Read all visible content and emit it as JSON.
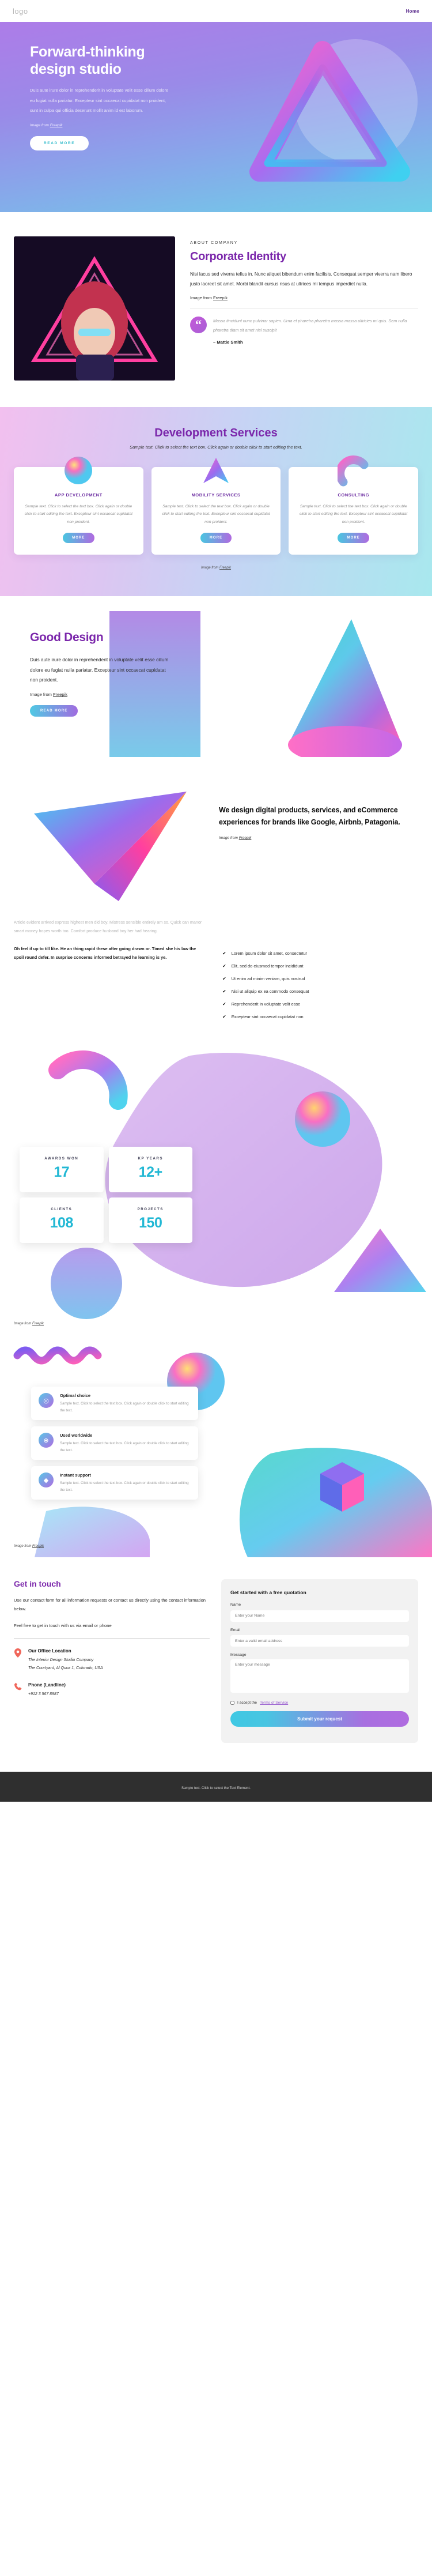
{
  "nav": {
    "logo": "logo",
    "home": "Home"
  },
  "hero": {
    "title": "Forward-thinking design studio",
    "body": "Duis aute irure dolor in reprehenderit in voluptate velit esse cillum dolore eu fugiat nulla pariatur. Excepteur sint occaecat cupidatat non proident, sunt in culpa qui officia deserunt mollit anim id est laborum.",
    "credit_prefix": "Image from ",
    "credit_link": "Freepik",
    "cta": "READ MORE"
  },
  "about": {
    "eyebrow": "ABOUT COMPANY",
    "title": "Corporate Identity",
    "body": "Nisi lacus sed viverra tellus in. Nunc aliquet bibendum enim facilisis. Consequat semper viverra nam libero justo laoreet sit amet. Morbi blandit cursus risus at ultrices mi tempus imperdiet nulla.",
    "credit_prefix": "Image from ",
    "credit_link": "Freepik",
    "quote_glyph": "“",
    "quote": "Massa tincidunt nunc pulvinar sapien. Urna et pharetra pharetra massa massa ultricies mi quis. Sem nulla pharetra diam sit amet nisl suscipit",
    "author": "– Mattie Smith"
  },
  "services": {
    "title": "Development Services",
    "subtitle": "Sample text. Click to select the text box. Click again or double click to start editing the text.",
    "credit_prefix": "Image from ",
    "credit_link": "Freepik",
    "cards": [
      {
        "title": "APP DEVELOPMENT",
        "body": "Sample text. Click to select the text box. Click again or double click to start editing the text. Excepteur sint occaecat cupidatat non proident.",
        "cta": "MORE"
      },
      {
        "title": "MOBILITY SERVICES",
        "body": "Sample text. Click to select the text box. Click again or double click to start editing the text. Excepteur sint occaecat cupidatat non proident.",
        "cta": "MORE"
      },
      {
        "title": "CONSULTING",
        "body": "Sample text. Click to select the text box. Click again or double click to start editing the text. Excepteur sint occaecat cupidatat non proident.",
        "cta": "MORE"
      }
    ]
  },
  "good_design": {
    "title": "Good Design",
    "body": "Duis aute irure dolor in reprehenderit in voluptate velit esse cillum dolore eu fugiat nulla pariatur. Excepteur sint occaecat cupidatat non proident.",
    "credit_prefix": "Image from ",
    "credit_link": "Freepik",
    "cta": "READ MORE"
  },
  "digital": {
    "title": "We design digital products, services, and eCommerce experiences for brands like Google, Airbnb, Patagonia.",
    "credit_prefix": "Image from ",
    "credit_link": "Freepik",
    "faded": "Article evident arrived express highest men did boy. Mistress sensible entirely am so. Quick can manor smart money hopes worth too. Comfort produce husband boy her had hearing.",
    "strong": "Oh feel if up to till like. He an thing rapid these after going drawn or. Timed she his law the spoil round defer. In surprise concerns informed betrayed he learning is ye.",
    "checks": [
      "Lorem ipsum dolor sit amet, consectetur",
      "Elit, sed do eiusmod tempor incididunt",
      "Ut enim ad minim veniam, quis nostrud",
      "Nisi ut aliquip ex ea commodo consequat",
      "Reprehenderit in voluptate velit esse",
      "Excepteur sint occaecat cupidatat non"
    ],
    "tick": "✔"
  },
  "stats": {
    "items": [
      {
        "label": "AWARDS WON",
        "value": "17"
      },
      {
        "label": "KP YEARS",
        "value": "12+"
      },
      {
        "label": "CLIENTS",
        "value": "108"
      },
      {
        "label": "PROJECTS",
        "value": "150"
      }
    ],
    "credit_prefix": "Image from ",
    "credit_link": "Freepik"
  },
  "features": {
    "items": [
      {
        "icon": "target-icon",
        "glyph": "◎",
        "title": "Optimal choice",
        "body": "Sample text. Click to select the text box. Click again or double click to start editing the text."
      },
      {
        "icon": "globe-icon",
        "glyph": "⊕",
        "title": "Used worldwide",
        "body": "Sample text. Click to select the text box. Click again or double click to start editing the text."
      },
      {
        "icon": "diamond-icon",
        "glyph": "◆",
        "title": "Instant support",
        "body": "Sample text. Click to select the text box. Click again or double click to start editing the text."
      }
    ],
    "credit_prefix": "Image from ",
    "credit_link": "Freepik"
  },
  "contact": {
    "title": "Get in touch",
    "intro": "Use our contact form for all information requests or contact us directly using the contact information below.",
    "note": "Feel free to get in touch with us via email or phone",
    "office_title": "Our Office Location",
    "office_line1": "The Interior Design Studio Company",
    "office_line2": "The Courtyard, Al Quoz 1, Colorado,  USA",
    "phone_title": "Phone (Landline)",
    "phone_value": "+912 3 567 8987",
    "form_title": "Get started with a free quotation",
    "name_label": "Name",
    "name_placeholder": "Enter your Name",
    "email_label": "Email",
    "email_placeholder": "Enter a valid email address",
    "message_label": "Message",
    "message_placeholder": "Enter your message",
    "tos_prefix": "I accept the ",
    "tos_link": "Terms of Service",
    "submit": "Submit your request"
  },
  "footer": {
    "text": "Sample text. Click to select the Text Element."
  },
  "colors": {
    "purple": "#7b27ab",
    "teal": "#22b8d4",
    "coral": "#f0665a"
  }
}
